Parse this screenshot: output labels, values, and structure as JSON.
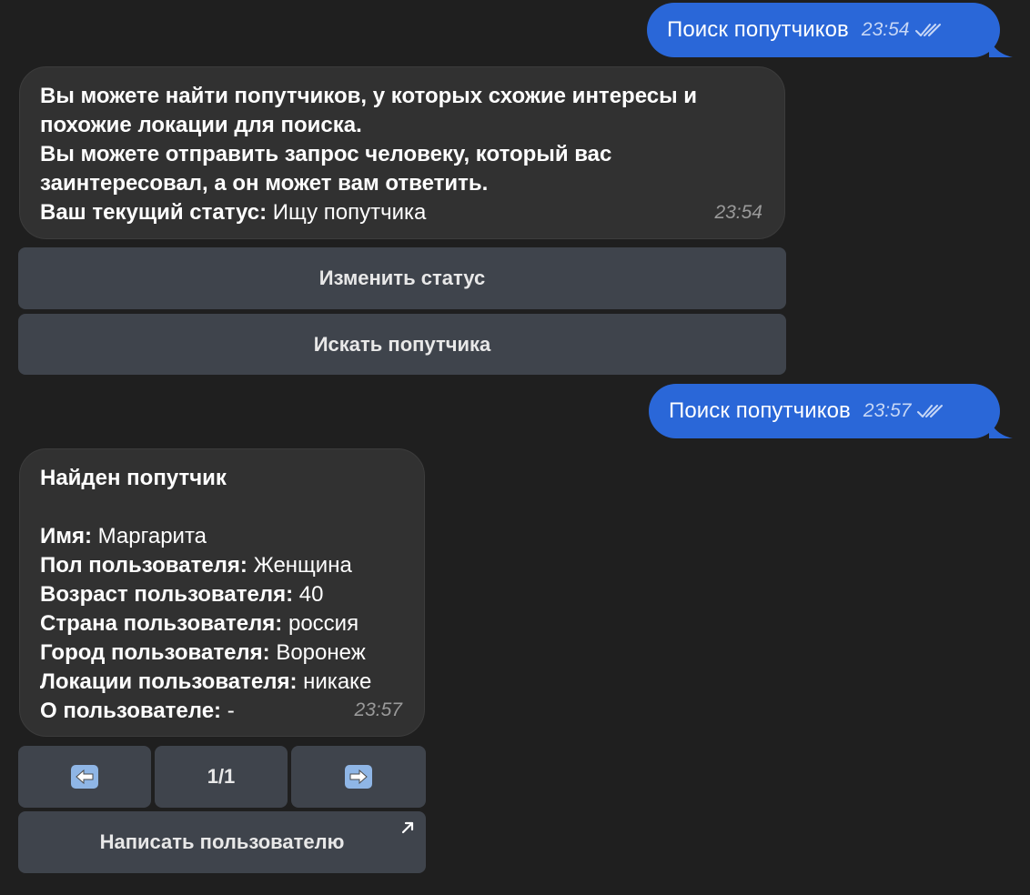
{
  "messages": {
    "out1": {
      "text": "Поиск попутчиков",
      "time": "23:54"
    },
    "in1": {
      "lines": [
        "Вы можете найти попутчиков, у которых схожие интересы и",
        "похожие локации для поиска.",
        "Вы можете отправить запрос человеку, который вас",
        "заинтересовал, а он может вам ответить."
      ],
      "status_label": "Ваш текущий статус:",
      "status_value": " Ищу попутчика",
      "time": "23:54"
    },
    "out2": {
      "text": "Поиск попутчиков",
      "time": "23:57"
    },
    "in2": {
      "heading": "Найден попутчик",
      "fields": [
        {
          "label": "Имя:",
          "value": " Маргарита"
        },
        {
          "label": "Пол пользователя:",
          "value": " Женщина"
        },
        {
          "label": "Возраст пользователя:",
          "value": " 40"
        },
        {
          "label": "Страна пользователя:",
          "value": " россия"
        },
        {
          "label": "Город пользователя:",
          "value": " Воронеж"
        },
        {
          "label": "Локации пользователя:",
          "value": " никаке"
        },
        {
          "label": "О пользователе:",
          "value": " -"
        }
      ],
      "time": "23:57"
    }
  },
  "keyboard1": {
    "change_status": "Изменить статус",
    "search_companion": "Искать попутчика"
  },
  "keyboard2": {
    "prev_icon": "left-arrow-icon",
    "page": "1/1",
    "next_icon": "right-arrow-icon",
    "write_user": "Написать пользователю",
    "write_icon": "external-link-arrow-icon"
  },
  "colors": {
    "background": "#1f1f1f",
    "outgoing": "#2a67d8",
    "incoming": "#313131",
    "button": "#3f444c"
  }
}
